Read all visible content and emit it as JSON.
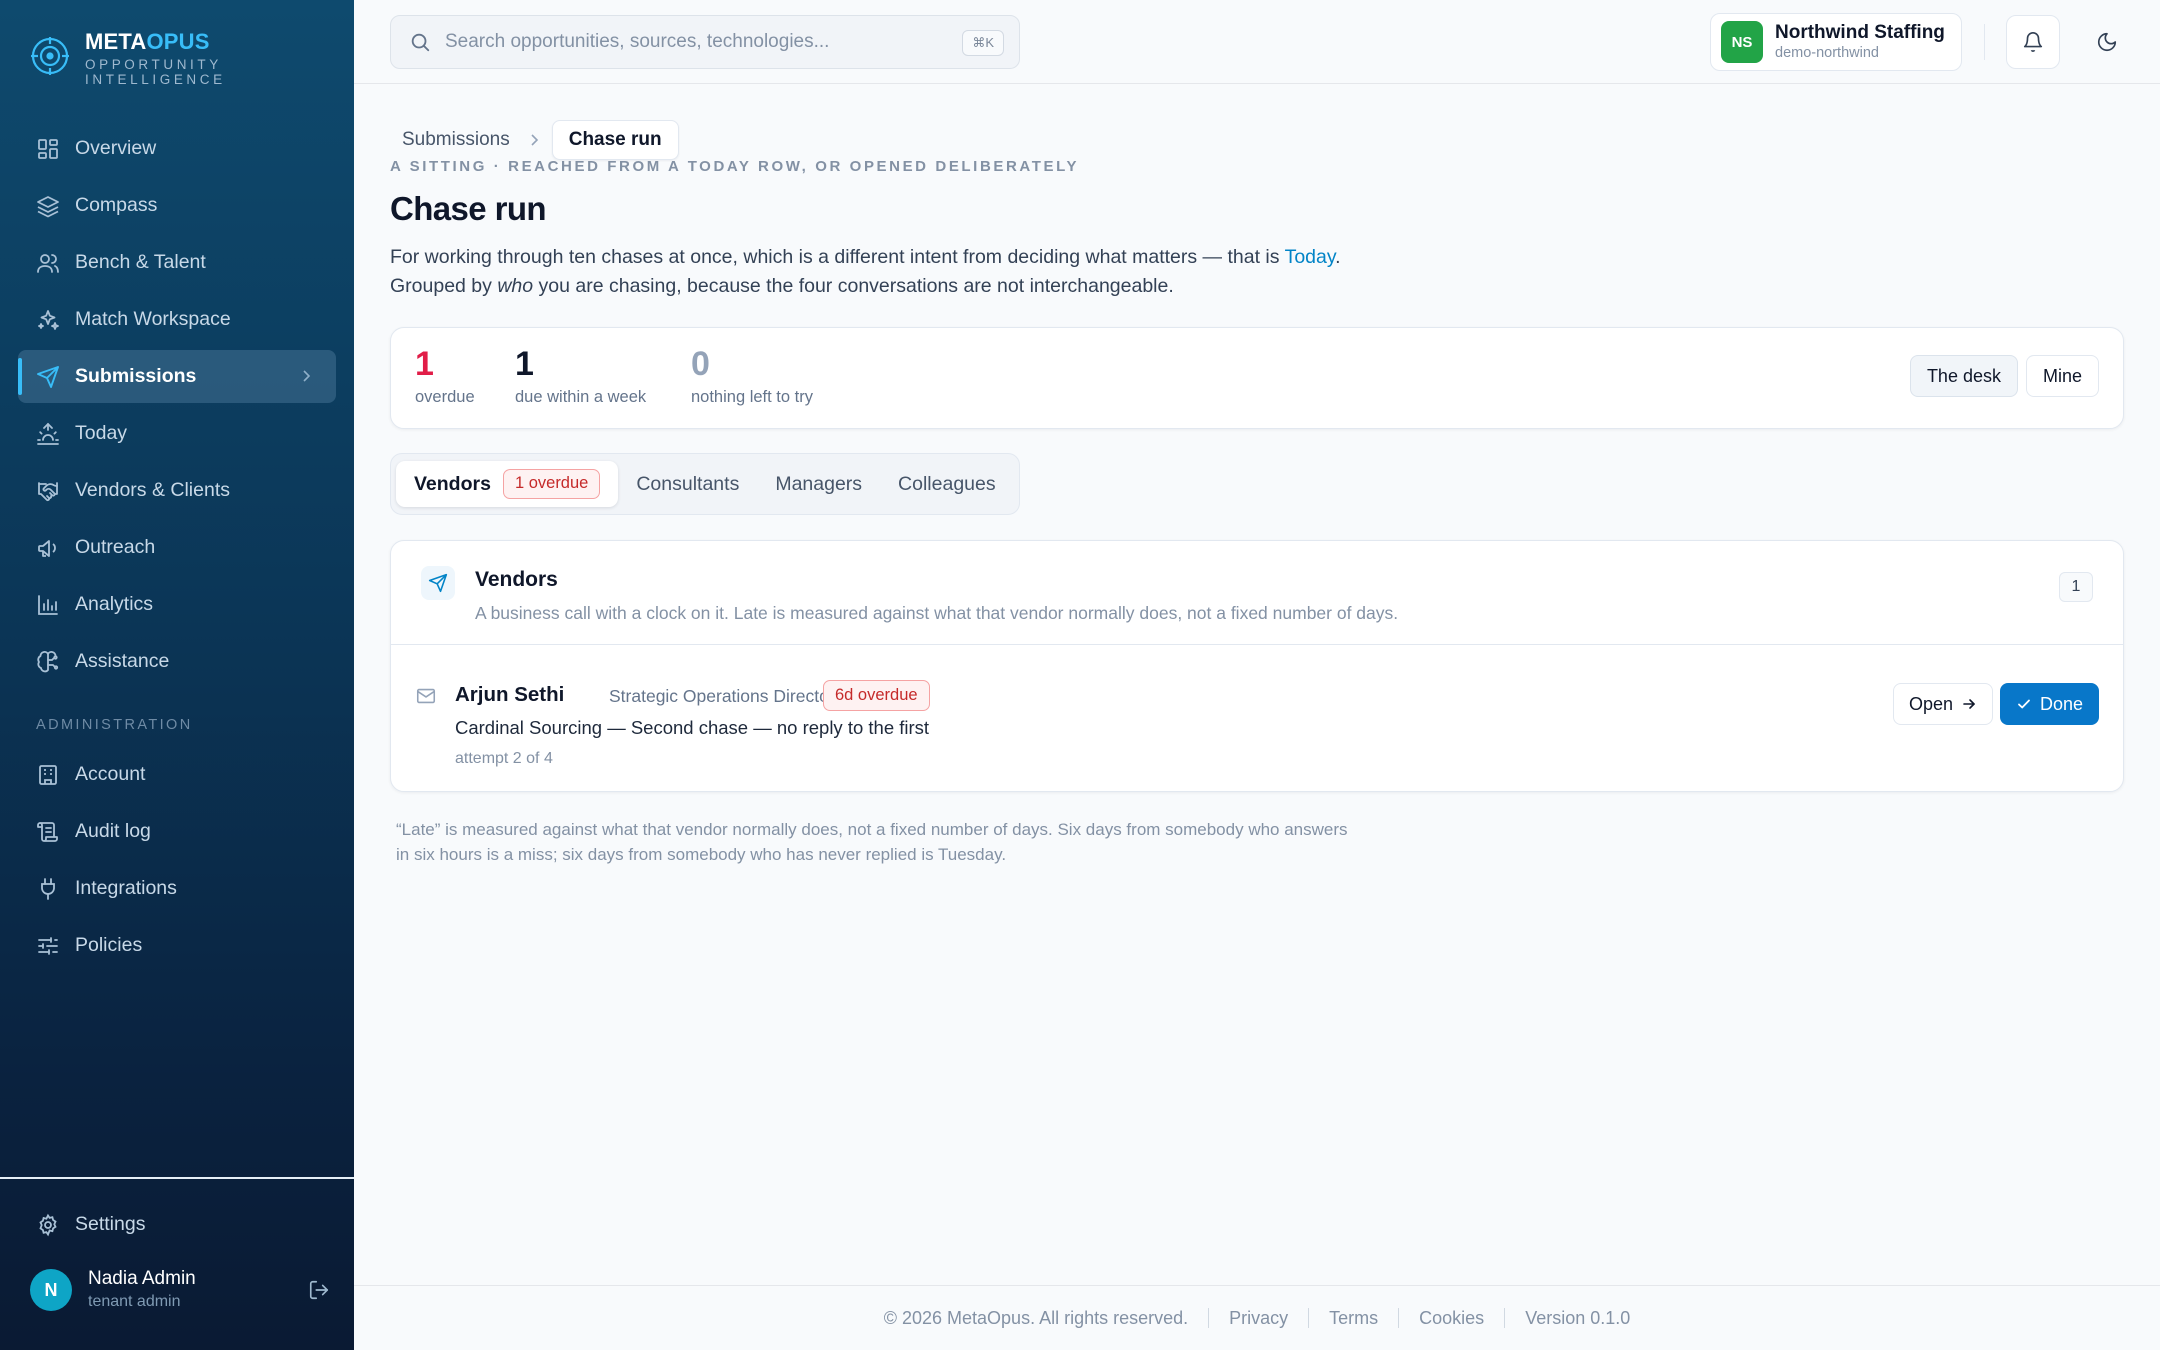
{
  "brand": {
    "name_part1": "META",
    "name_part2": "OPUS",
    "tagline_line1": "OPPORTUNITY",
    "tagline_line2": "INTELLIGENCE"
  },
  "sidebar": {
    "items": [
      {
        "label": "Overview",
        "icon": "grid-icon"
      },
      {
        "label": "Compass",
        "icon": "layers-icon"
      },
      {
        "label": "Bench & Talent",
        "icon": "users-icon"
      },
      {
        "label": "Match Workspace",
        "icon": "sparkles-icon"
      },
      {
        "label": "Submissions",
        "icon": "send-icon",
        "active": true
      },
      {
        "label": "Today",
        "icon": "sunrise-icon"
      },
      {
        "label": "Vendors & Clients",
        "icon": "handshake-icon"
      },
      {
        "label": "Outreach",
        "icon": "megaphone-icon"
      },
      {
        "label": "Analytics",
        "icon": "bar-chart-icon"
      },
      {
        "label": "Assistance",
        "icon": "brain-icon"
      }
    ],
    "admin_label": "ADMINISTRATION",
    "admin_items": [
      {
        "label": "Account",
        "icon": "building-icon"
      },
      {
        "label": "Audit log",
        "icon": "scroll-icon"
      },
      {
        "label": "Integrations",
        "icon": "plug-icon"
      },
      {
        "label": "Policies",
        "icon": "sliders-icon"
      }
    ],
    "settings_label": "Settings",
    "user": {
      "initial": "N",
      "name": "Nadia Admin",
      "role": "tenant admin"
    }
  },
  "topbar": {
    "search_placeholder": "Search opportunities, sources, technologies...",
    "shortcut": "⌘K",
    "org": {
      "initials": "NS",
      "name": "Northwind Staffing",
      "slug": "demo-northwind"
    }
  },
  "breadcrumb": {
    "parent": "Submissions",
    "current": "Chase run"
  },
  "page": {
    "eyebrow": "A SITTING · REACHED FROM A TODAY ROW, OR OPENED DELIBERATELY",
    "title": "Chase run",
    "intro_part1": "For working through ten chases at once, which is a different intent from deciding what matters — that is ",
    "intro_link": "Today",
    "intro_part2": ".",
    "intro_line2_a": "Grouped by ",
    "intro_line2_em": "who",
    "intro_line2_b": " you are chasing, because the four conversations are not interchangeable."
  },
  "stats": [
    {
      "value": "1",
      "label": "overdue",
      "color": "#e11d48"
    },
    {
      "value": "1",
      "label": "due within a week",
      "color": "#0f172a"
    },
    {
      "value": "0",
      "label": "nothing left to try",
      "color": "#94a3b8"
    }
  ],
  "scope": {
    "desk": "The desk",
    "mine": "Mine"
  },
  "tabs": [
    {
      "label": "Vendors",
      "badge": "1 overdue",
      "active": true
    },
    {
      "label": "Consultants"
    },
    {
      "label": "Managers"
    },
    {
      "label": "Colleagues"
    }
  ],
  "group": {
    "title": "Vendors",
    "description": "A business call with a clock on it. Late is measured against what that vendor normally does, not a fixed number of days.",
    "count": "1",
    "rows": [
      {
        "name": "Arjun Sethi",
        "role": "Strategic Operations Director",
        "badge": "6d overdue",
        "detail": "Cardinal Sourcing — Second chase — no reply to the first",
        "attempt": "attempt 2 of 4",
        "open_label": "Open",
        "done_label": "Done"
      }
    ]
  },
  "footnote": "“Late” is measured against what that vendor normally does, not a fixed number of days. Six days from somebody who answers in six hours is a miss; six days from somebody who has never replied is Tuesday.",
  "footer": {
    "copyright": "© 2026 MetaOpus. All rights reserved.",
    "privacy": "Privacy",
    "terms": "Terms",
    "cookies": "Cookies",
    "version": "Version 0.1.0"
  },
  "colors": {
    "accent": "#0877c9",
    "brand_accent": "#38bdf8",
    "overdue": "#c52a2a"
  }
}
